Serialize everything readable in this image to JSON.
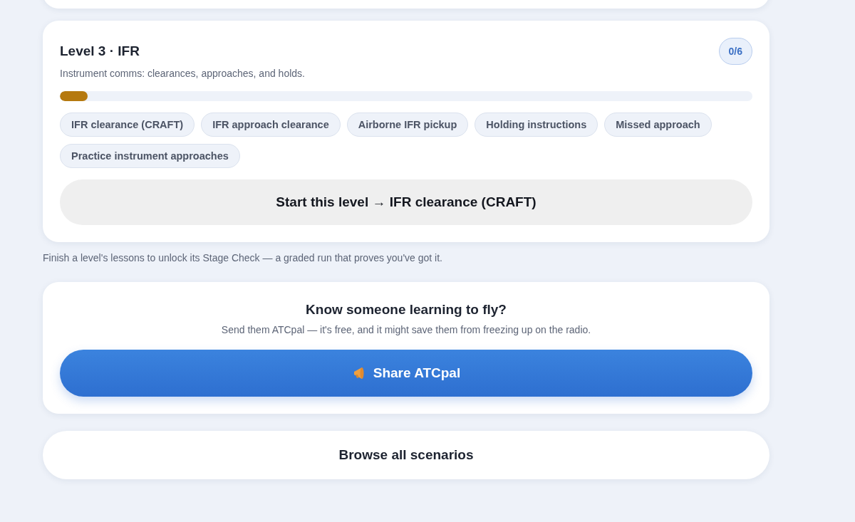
{
  "level_card": {
    "title": "Level 3 · IFR",
    "count": "0/6",
    "description": "Instrument comms: clearances, approaches, and holds.",
    "progress": {
      "level": 0.04
    },
    "lessons": [
      {
        "label": "IFR clearance (CRAFT)"
      },
      {
        "label": "IFR approach clearance"
      },
      {
        "label": "Airborne IFR pickup"
      },
      {
        "label": "Holding instructions"
      },
      {
        "label": "Missed approach"
      },
      {
        "label": "Practice instrument approaches"
      }
    ],
    "start_button": "Start this level → IFR clearance (CRAFT)"
  },
  "stage_note": "Finish a level's lessons to unlock its Stage Check — a graded run that proves you've got it.",
  "share_card": {
    "title": "Know someone learning to fly?",
    "subtitle": "Send them ATCpal — it's free, and it might save them from freezing up on the radio.",
    "button": "Share ATCpal"
  },
  "browse_button": "Browse all scenarios"
}
